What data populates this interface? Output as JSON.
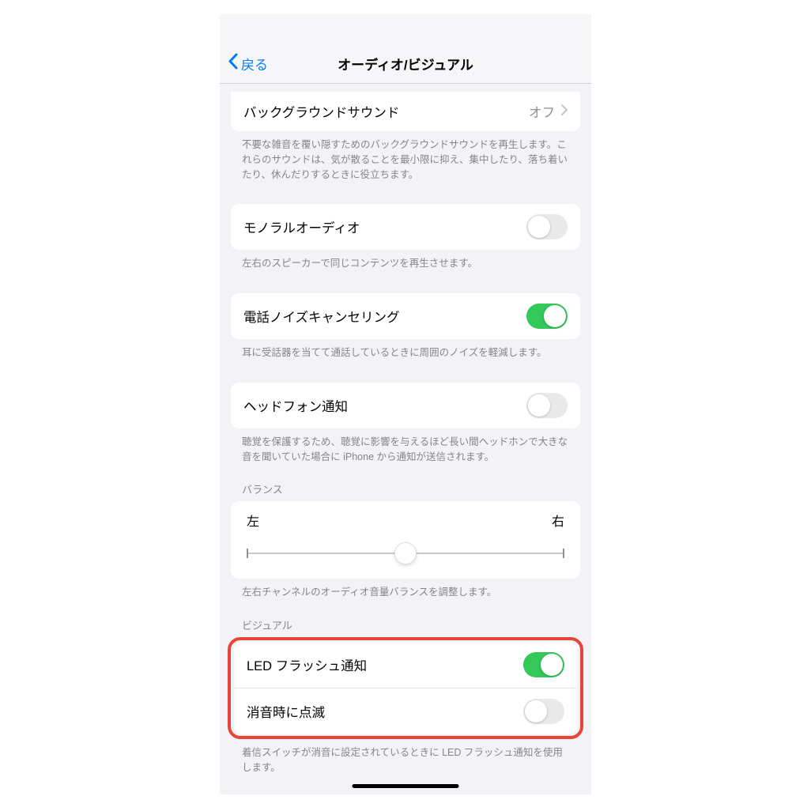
{
  "nav": {
    "back": "戻る",
    "title": "オーディオ/ビジュアル"
  },
  "background_sounds": {
    "label": "バックグラウンドサウンド",
    "value": "オフ",
    "footer": "不要な雑音を覆い隠すためのバックグラウンドサウンドを再生します。これらのサウンドは、気が散ることを最小限に抑え、集中したり、落ち着いたり、休んだりするときに役立ちます。"
  },
  "mono_audio": {
    "label": "モノラルオーディオ",
    "on": false,
    "footer": "左右のスピーカーで同じコンテンツを再生させます。"
  },
  "noise_cancel": {
    "label": "電話ノイズキャンセリング",
    "on": true,
    "footer": "耳に受話器を当てて通話しているときに周囲のノイズを軽減します。"
  },
  "headphone_notify": {
    "label": "ヘッドフォン通知",
    "on": false,
    "footer": "聴覚を保護するため、聴覚に影響を与えるほど長い間ヘッドホンで大きな音を聞いていた場合に iPhone から通知が送信されます。"
  },
  "balance": {
    "header": "バランス",
    "left": "左",
    "right": "右",
    "footer": "左右チャンネルのオーディオ音量バランスを調整します。"
  },
  "visual": {
    "header": "ビジュアル",
    "led_flash": {
      "label": "LED フラッシュ通知",
      "on": true
    },
    "flash_on_silent": {
      "label": "消音時に点滅",
      "on": false
    },
    "footer": "着信スイッチが消音に設定されているときに LED フラッシュ通知を使用します。"
  }
}
